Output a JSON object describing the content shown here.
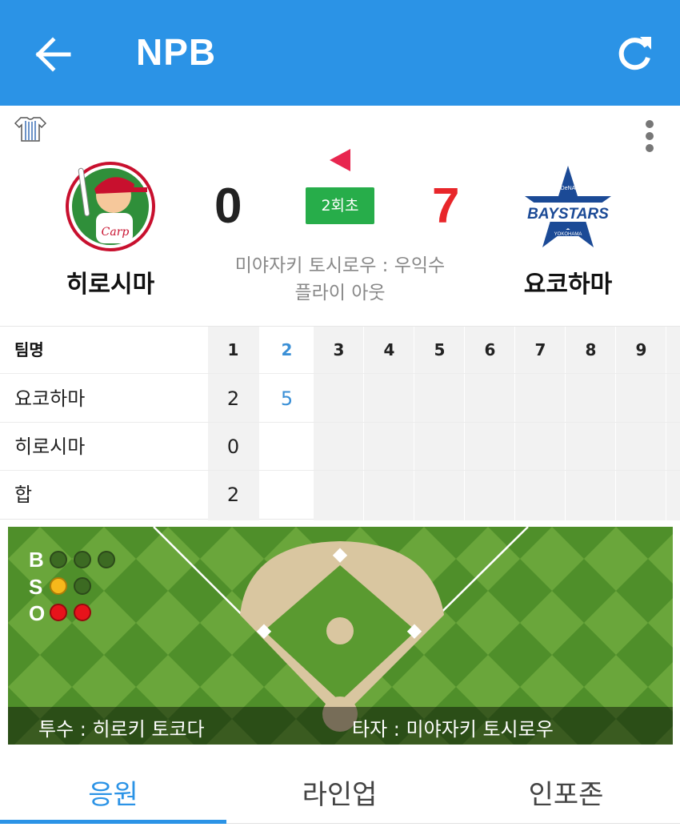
{
  "header": {
    "title": "NPB"
  },
  "game": {
    "home_team": "히로시마",
    "away_team": "요코하마",
    "home_score": "0",
    "away_score": "7",
    "inning": "2회초",
    "play_line1": "미야자키 토시로우 : 우익수",
    "play_line2": "플라이 아웃"
  },
  "linescore": {
    "header_label": "팀명",
    "innings": [
      "1",
      "2",
      "3",
      "4",
      "5",
      "6",
      "7",
      "8",
      "9"
    ],
    "rows": [
      {
        "team": "요코하마",
        "scores": [
          "2",
          "5",
          "",
          "",
          "",
          "",
          "",
          "",
          ""
        ]
      },
      {
        "team": "히로시마",
        "scores": [
          "0",
          "",
          "",
          "",
          "",
          "",
          "",
          "",
          ""
        ]
      },
      {
        "team": "합",
        "scores": [
          "2",
          "",
          "",
          "",
          "",
          "",
          "",
          "",
          ""
        ]
      }
    ]
  },
  "count": {
    "labels": {
      "balls": "B",
      "strikes": "S",
      "outs": "O"
    },
    "balls": 0,
    "strikes": 1,
    "outs": 2
  },
  "field": {
    "pitcher": "투수 : 히로키 토코다",
    "batter": "타자 : 미야자키 토시로우"
  },
  "tabs": [
    "응원",
    "라인업",
    "인포존"
  ],
  "colors": {
    "header": "#2b93e6",
    "away_score": "#e8262a",
    "inning_badge": "#27ad4a",
    "current_inning": "#3a8fd6"
  }
}
